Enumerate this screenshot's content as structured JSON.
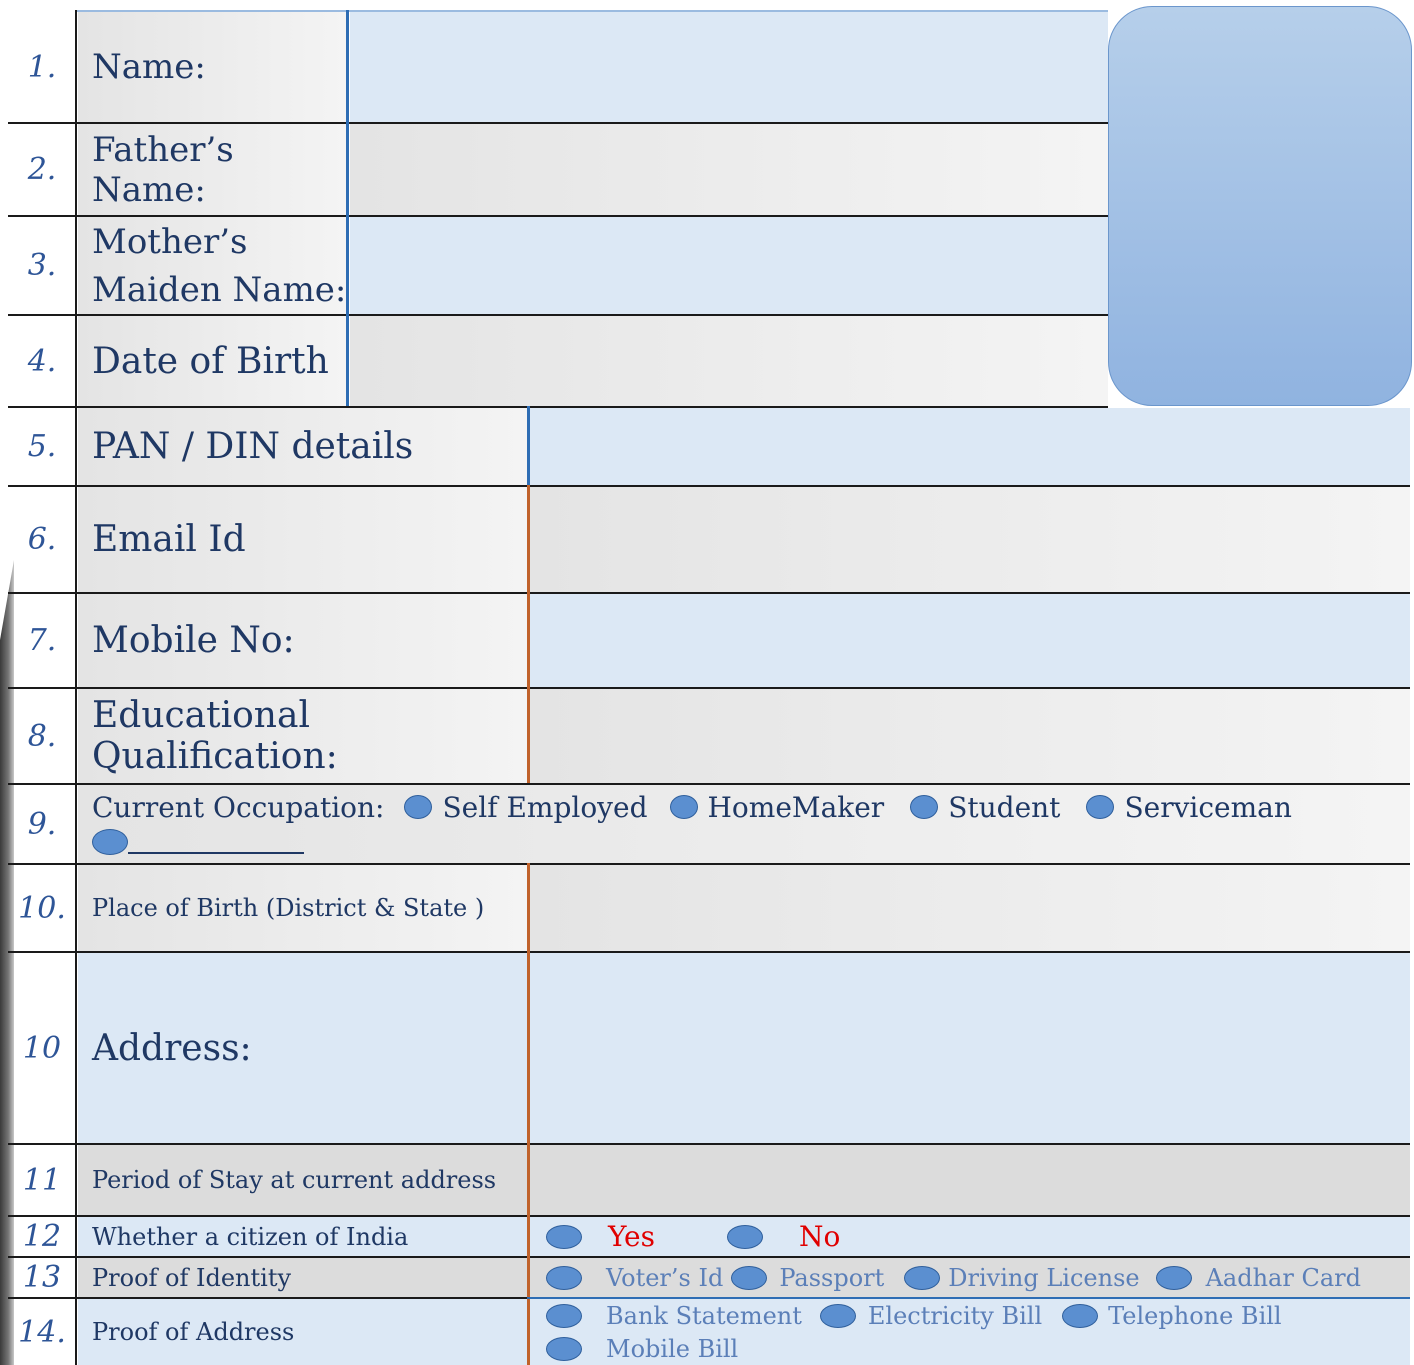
{
  "rows": {
    "r1": {
      "num": "1.",
      "label": "Name:"
    },
    "r2": {
      "num": "2.",
      "label": "Father’s Name:"
    },
    "r3": {
      "num": "3.",
      "label_line1": "Mother’s",
      "label_line2": "Maiden Name:"
    },
    "r4": {
      "num": "4.",
      "label": "Date of Birth"
    },
    "r5": {
      "num": "5.",
      "label": "PAN / DIN details"
    },
    "r6": {
      "num": "6.",
      "label": "Email Id"
    },
    "r7": {
      "num": "7.",
      "label": "Mobile No:"
    },
    "r8": {
      "num": "8.",
      "label": "Educational Qualification:"
    },
    "r9": {
      "num": "9.",
      "label": "Current Occupation:",
      "options": [
        "Self Employed",
        "HomeMaker",
        "Student",
        "Serviceman"
      ]
    },
    "r10a": {
      "num": "10.",
      "label": "Place of Birth (District & State )"
    },
    "r10b": {
      "num": "10",
      "label": "Address:"
    },
    "r11": {
      "num": "11",
      "label": "Period of Stay at current address"
    },
    "r12": {
      "num": "12",
      "label": "Whether a citizen of India",
      "options": [
        "Yes",
        "No"
      ]
    },
    "r13": {
      "num": "13",
      "label": "Proof of Identity",
      "options": [
        "Voter’s Id",
        "Passport",
        "Driving License",
        "Aadhar Card"
      ]
    },
    "r14": {
      "num": "14.",
      "label": "Proof of Address",
      "options": [
        "Bank Statement",
        "Electricity Bill",
        "Telephone Bill",
        "Mobile Bill"
      ]
    }
  },
  "colors": {
    "label_text": "#1f3864",
    "number_text": "#2e5597",
    "yes_no_text": "#e00000",
    "option_muted_text": "#5b7fb8",
    "radio_fill": "#5b8fd0",
    "photo_box": "#a6c3e6"
  }
}
